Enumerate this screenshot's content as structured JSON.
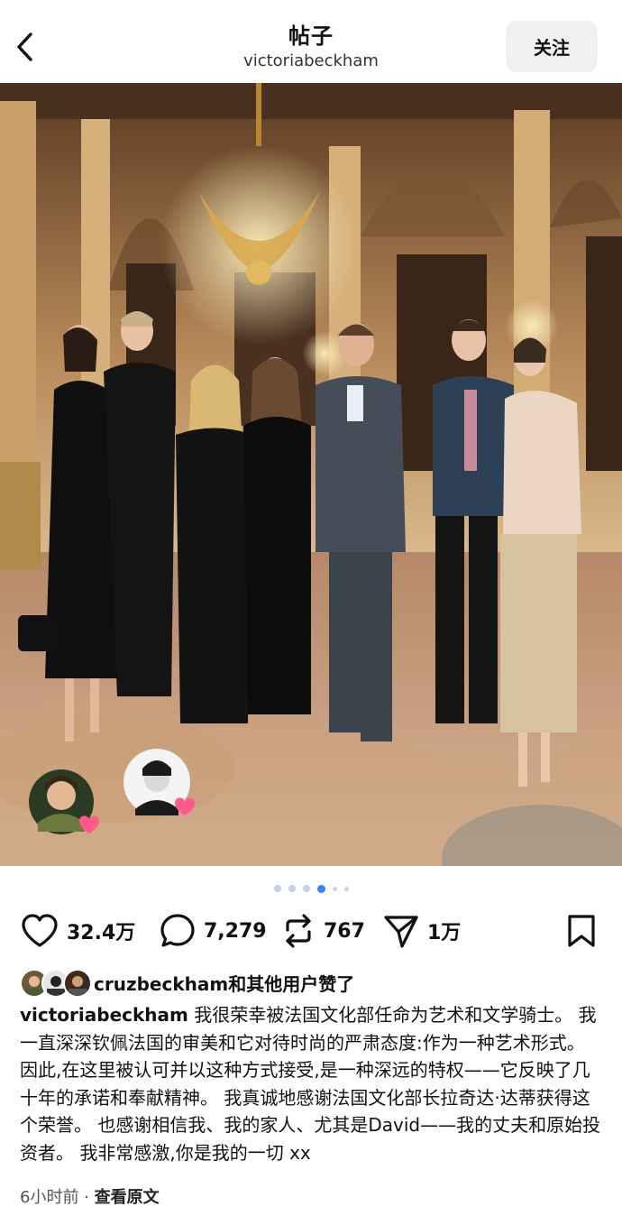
{
  "header": {
    "title": "帖子",
    "subtitle": "victoriabeckham",
    "follow_label": "关注"
  },
  "carousel": {
    "total_dots": 6,
    "active_index": 3
  },
  "actions": {
    "likes": "32.4万",
    "comments": "7,279",
    "reposts": "767",
    "shares": "1万"
  },
  "liked_by": {
    "username": "cruzbeckham",
    "suffix": "和其他用户赞了"
  },
  "caption": {
    "username": "victoriabeckham",
    "text": "我很荣幸被法国文化部任命为艺术和文学骑士。 我一直深深钦佩法国的审美和它对待时尚的严肃态度:作为一种艺术形式。 因此,在这里被认可并以这种方式接受,是一种深远的特权——它反映了几十年的承诺和奉献精神。 我真诚地感谢法国文化部长拉奇达·达蒂获得这个荣誉。 也感谢相信我、我的家人、尤其是David——我的丈夫和原始投资者。 我非常感激,你是我的一切 xx"
  },
  "meta": {
    "time": "6小时前",
    "separator": " · ",
    "view_original": "查看原文"
  },
  "colors": {
    "accent": "#3b82f6",
    "heart_sticker": "#ff5a8a",
    "follow_bg": "#eef0f2"
  }
}
